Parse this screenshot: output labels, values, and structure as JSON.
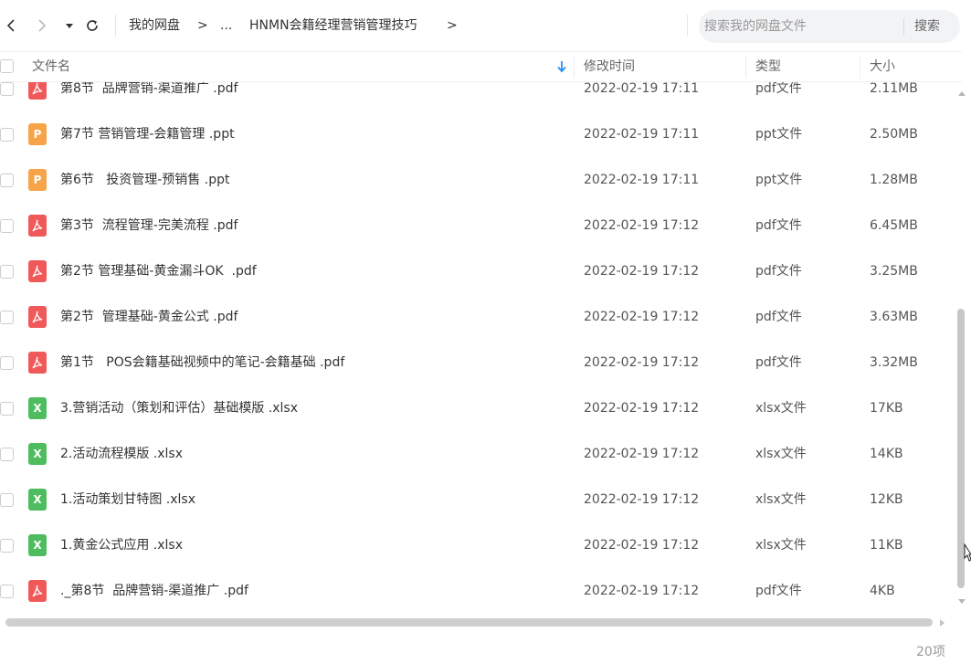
{
  "toolbar": {
    "breadcrumb": [
      "我的网盘",
      "...",
      "HNMN会籍经理营销管理技巧"
    ],
    "crumb_sep": ">",
    "search_placeholder": "搜索我的网盘文件",
    "search_button": "搜索"
  },
  "header": {
    "name": "文件名",
    "modified": "修改时间",
    "type": "类型",
    "size": "大小"
  },
  "files": [
    {
      "name": "第8节  品牌营销-渠道推广 .pdf",
      "date": "2022-02-19 17:11",
      "type": "pdf文件",
      "size": "2.11MB",
      "icon": "pdf"
    },
    {
      "name": "第7节 营销管理-会籍管理 .ppt",
      "date": "2022-02-19 17:11",
      "type": "ppt文件",
      "size": "2.50MB",
      "icon": "ppt"
    },
    {
      "name": "第6节   投资管理-预销售 .ppt",
      "date": "2022-02-19 17:11",
      "type": "ppt文件",
      "size": "1.28MB",
      "icon": "ppt"
    },
    {
      "name": "第3节  流程管理-完美流程 .pdf",
      "date": "2022-02-19 17:12",
      "type": "pdf文件",
      "size": "6.45MB",
      "icon": "pdf"
    },
    {
      "name": "第2节 管理基础-黄金漏斗OK  .pdf",
      "date": "2022-02-19 17:12",
      "type": "pdf文件",
      "size": "3.25MB",
      "icon": "pdf"
    },
    {
      "name": "第2节  管理基础-黄金公式 .pdf",
      "date": "2022-02-19 17:12",
      "type": "pdf文件",
      "size": "3.63MB",
      "icon": "pdf"
    },
    {
      "name": "第1节   POS会籍基础视频中的笔记-会籍基础 .pdf",
      "date": "2022-02-19 17:12",
      "type": "pdf文件",
      "size": "3.32MB",
      "icon": "pdf"
    },
    {
      "name": "3.营销活动（策划和评估）基础模版 .xlsx",
      "date": "2022-02-19 17:12",
      "type": "xlsx文件",
      "size": "17KB",
      "icon": "xlsx"
    },
    {
      "name": "2.活动流程模版 .xlsx",
      "date": "2022-02-19 17:12",
      "type": "xlsx文件",
      "size": "14KB",
      "icon": "xlsx"
    },
    {
      "name": "1.活动策划甘特图 .xlsx",
      "date": "2022-02-19 17:12",
      "type": "xlsx文件",
      "size": "12KB",
      "icon": "xlsx"
    },
    {
      "name": "1.黄金公式应用 .xlsx",
      "date": "2022-02-19 17:12",
      "type": "xlsx文件",
      "size": "11KB",
      "icon": "xlsx"
    },
    {
      "name": "._第8节  品牌营销-渠道推广 .pdf",
      "date": "2022-02-19 17:12",
      "type": "pdf文件",
      "size": "4KB",
      "icon": "pdf"
    }
  ],
  "icon_glyphs": {
    "ppt": "P",
    "xlsx": "X"
  },
  "footer": {
    "count": "20项"
  },
  "colors": {
    "pdf": "#f0595a",
    "ppt": "#f7a348",
    "xlsx": "#4fbd5f",
    "sort_arrow": "#2a8cf0"
  }
}
